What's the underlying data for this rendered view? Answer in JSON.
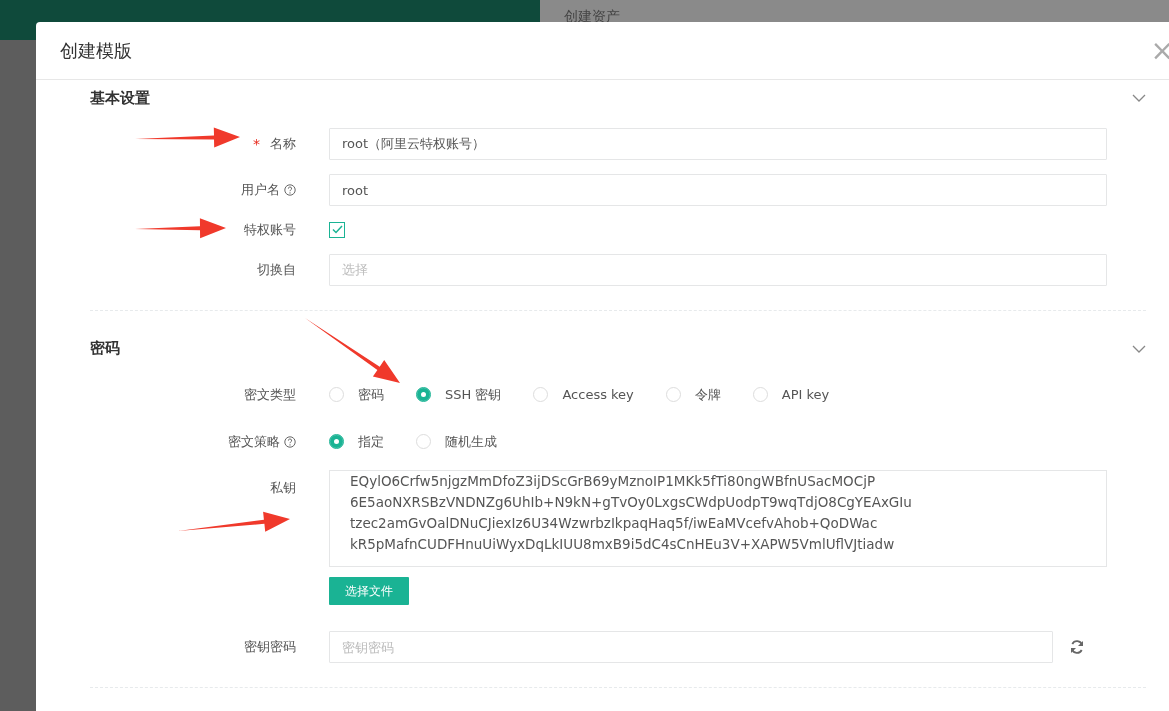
{
  "background": {
    "page_title": "创建资产"
  },
  "required_symbol": "*",
  "modal": {
    "title": "创建模版",
    "close": "×"
  },
  "sections": [
    {
      "title": "基本设置",
      "expanded": true,
      "fields": [
        {
          "kind": "text",
          "label": "名称",
          "required": true,
          "help": false,
          "value": "root（阿里云特权账号）"
        },
        {
          "kind": "text",
          "label": "用户名",
          "required": false,
          "help": true,
          "value": "root"
        },
        {
          "kind": "checkbox",
          "label": "特权账号",
          "required": false,
          "help": false,
          "checked": true
        },
        {
          "kind": "select",
          "label": "切换自",
          "required": false,
          "help": false,
          "placeholder": "选择"
        }
      ]
    },
    {
      "title": "密码",
      "expanded": true,
      "fields": [
        {
          "kind": "radio",
          "label": "密文类型",
          "required": false,
          "help": false,
          "options": [
            {
              "label": "密码",
              "selected": false
            },
            {
              "label": "SSH 密钥",
              "selected": true
            },
            {
              "label": "Access key",
              "selected": false
            },
            {
              "label": "令牌",
              "selected": false
            },
            {
              "label": "API key",
              "selected": false
            }
          ]
        },
        {
          "kind": "radio",
          "label": "密文策略",
          "required": false,
          "help": true,
          "options": [
            {
              "label": "指定",
              "selected": true
            },
            {
              "label": "随机生成",
              "selected": false
            }
          ]
        },
        {
          "kind": "textarea",
          "label": "私钥",
          "required": false,
          "help": false,
          "button": "选择文件",
          "lines": [
            "EQylO6Crfw5njgzMmDfoZ3ijDScGrB69yMznoIP1MKk5fTi80ngWBfnUSacMOCjP",
            "6E5aoNXRSBzVNDNZg6UhIb+N9kN+gTvOy0LxgsCWdpUodpT9wqTdjO8CgYEAxGIu",
            "tzec2amGvOalDNuCJiexIz6U34WzwrbzIkpaqHaq5f/iwEaMVcefvAhob+QoDWac",
            "kR5pMafnCUDFHnuUiWyxDqLkIUU8mxB9i5dC4sCnHEu3V+XAPW5VmlUflVJtiadw"
          ]
        },
        {
          "kind": "password",
          "label": "密钥密码",
          "required": false,
          "help": false,
          "placeholder": "密钥密码"
        }
      ]
    }
  ]
}
